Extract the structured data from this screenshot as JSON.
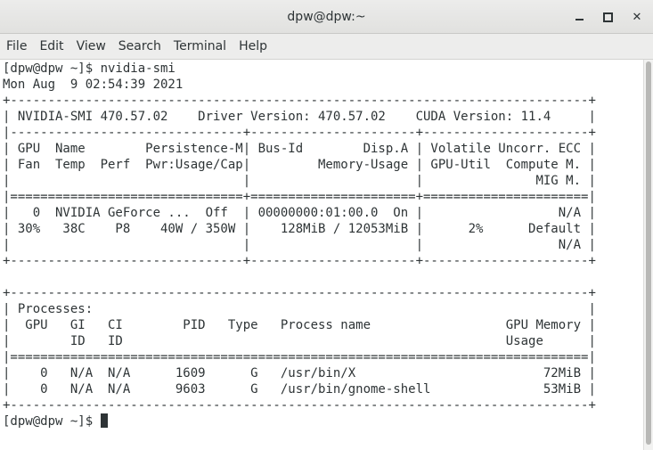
{
  "window": {
    "title": "dpw@dpw:~",
    "controls": {
      "minimize_icon": "minimize-icon",
      "maximize_icon": "maximize-icon",
      "close_icon": "close-icon",
      "close_glyph": "✕"
    }
  },
  "menubar": {
    "items": [
      "File",
      "Edit",
      "View",
      "Search",
      "Terminal",
      "Help"
    ]
  },
  "terminal": {
    "prompt": "[dpw@dpw ~]$ ",
    "lines": [
      "[dpw@dpw ~]$ nvidia-smi",
      "Mon Aug  9 02:54:39 2021",
      "+-----------------------------------------------------------------------------+",
      "| NVIDIA-SMI 470.57.02    Driver Version: 470.57.02    CUDA Version: 11.4     |",
      "|-------------------------------+----------------------+----------------------+",
      "| GPU  Name        Persistence-M| Bus-Id        Disp.A | Volatile Uncorr. ECC |",
      "| Fan  Temp  Perf  Pwr:Usage/Cap|         Memory-Usage | GPU-Util  Compute M. |",
      "|                               |                      |               MIG M. |",
      "|===============================+======================+======================|",
      "|   0  NVIDIA GeForce ...  Off  | 00000000:01:00.0  On |                  N/A |",
      "| 30%   38C    P8    40W / 350W |    128MiB / 12053MiB |      2%      Default |",
      "|                               |                      |                  N/A |",
      "+-------------------------------+----------------------+----------------------+",
      "",
      "+-----------------------------------------------------------------------------+",
      "| Processes:                                                                  |",
      "|  GPU   GI   CI        PID   Type   Process name                  GPU Memory |",
      "|        ID   ID                                                   Usage      |",
      "|=============================================================================|",
      "|    0   N/A  N/A      1609      G   /usr/bin/X                         72MiB |",
      "|    0   N/A  N/A      9603      G   /usr/bin/gnome-shell               53MiB |",
      "+-----------------------------------------------------------------------------+"
    ]
  },
  "colors": {
    "text": "#2e3436",
    "background": "#ffffff",
    "titlebar": "#e6e6e4"
  }
}
